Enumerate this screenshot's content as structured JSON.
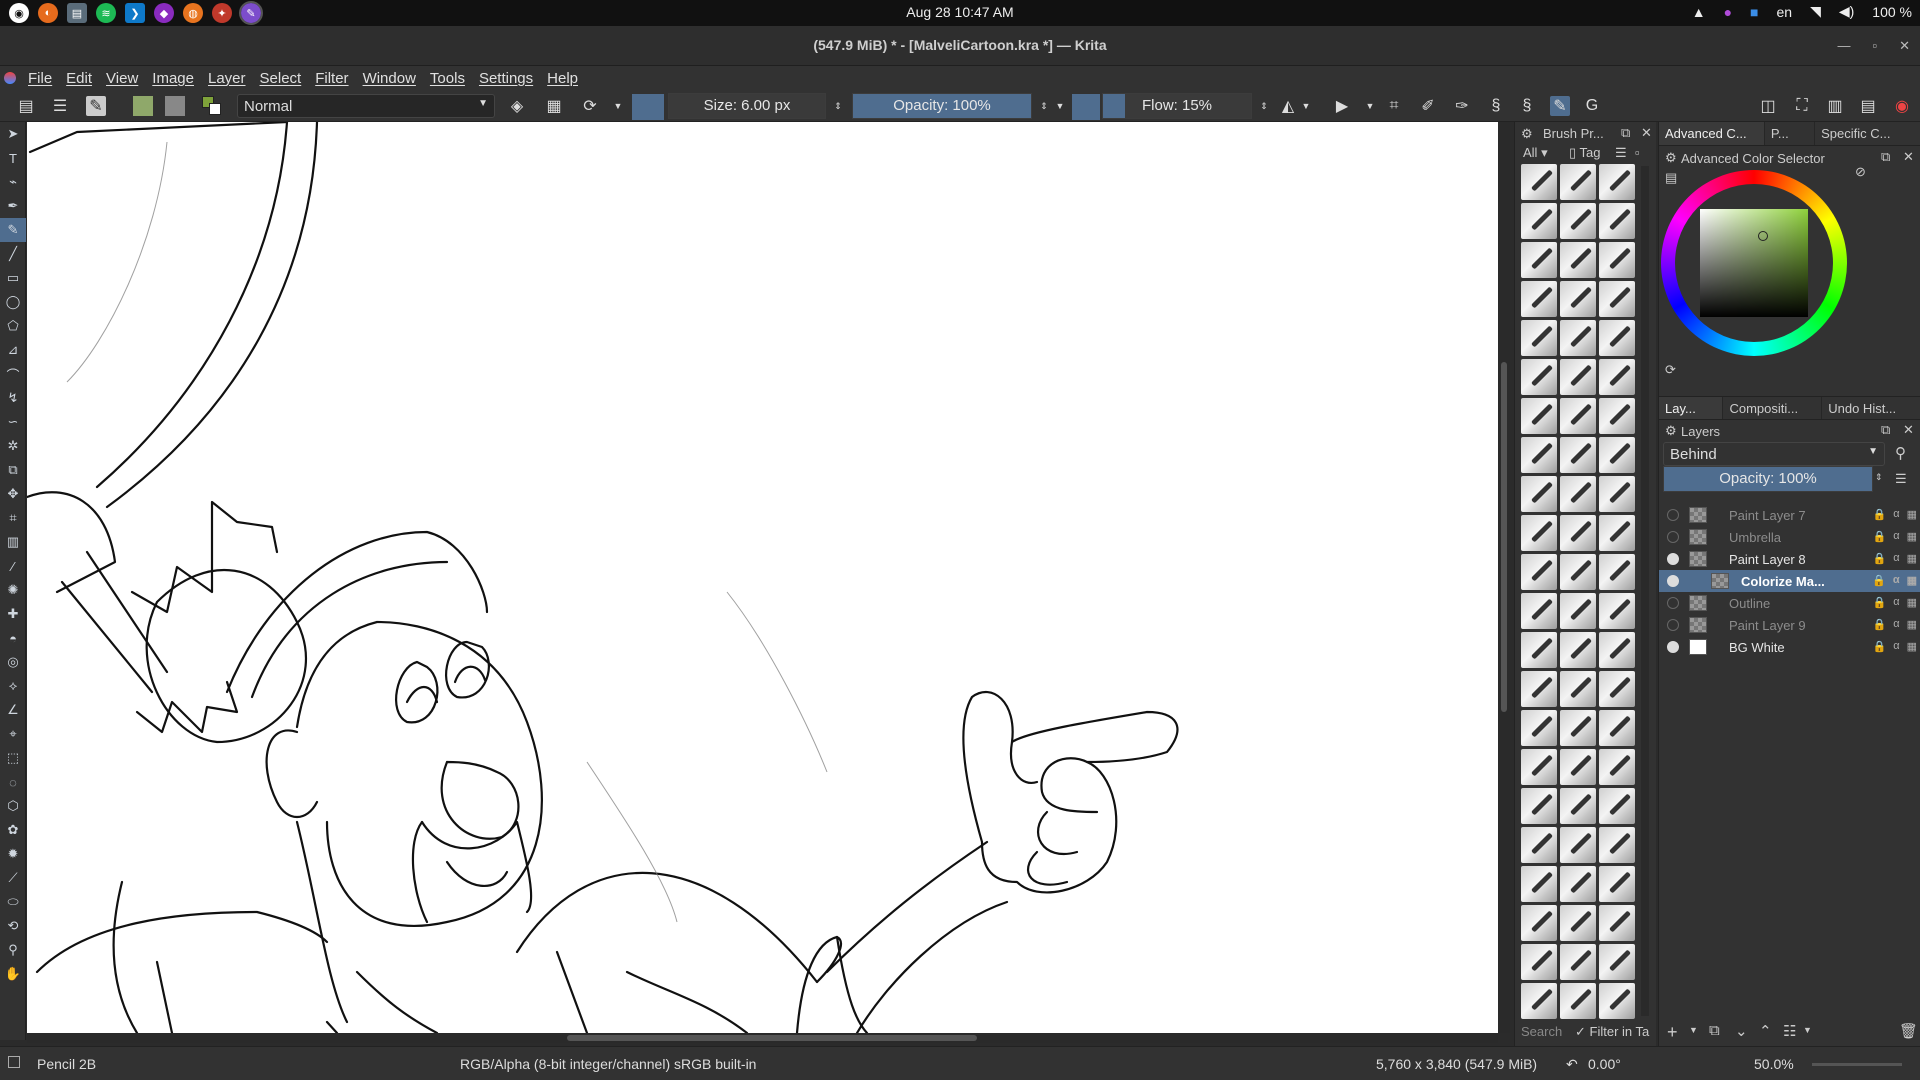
{
  "system": {
    "clock": "Aug 28  10:47 AM",
    "lang": "en",
    "battery": "100 %"
  },
  "window": {
    "title": "(547.9 MiB)  * - [MalveliCartoon.kra *] — Krita"
  },
  "menubar": [
    "File",
    "Edit",
    "View",
    "Image",
    "Layer",
    "Select",
    "Filter",
    "Window",
    "Tools",
    "Settings",
    "Help"
  ],
  "toolbar": {
    "blend_mode": "Normal",
    "size_label": "Size: 6.00 px",
    "opacity_label": "Opacity: 100%",
    "opacity_value": 1.0,
    "flow_label": "Flow: 15%",
    "flow_value": 0.15
  },
  "brush_presets": {
    "title": "Brush Pr...",
    "filter_tag": "All",
    "tag_label": "Tag",
    "search_placeholder": "Search",
    "filter_in_tag": "Filter in Ta"
  },
  "color_panel": {
    "tabs": [
      "Advanced C...",
      "P...",
      "Specific C..."
    ],
    "title": "Advanced Color Selector",
    "selected_color": "#7fa33a"
  },
  "layers_panel": {
    "tabs": [
      "Lay...",
      "Compositi...",
      "Undo Hist..."
    ],
    "title": "Layers",
    "blend_mode": "Behind",
    "opacity_label": "Opacity:  100%",
    "layers": [
      {
        "name": "Paint Layer 7",
        "visible": false,
        "selected": false
      },
      {
        "name": "Umbrella",
        "visible": false,
        "selected": false
      },
      {
        "name": "Paint Layer 8",
        "visible": true,
        "selected": false
      },
      {
        "name": "Colorize Ma...",
        "visible": true,
        "selected": true
      },
      {
        "name": "Outline",
        "visible": false,
        "selected": false
      },
      {
        "name": "Paint Layer 9",
        "visible": false,
        "selected": false
      },
      {
        "name": "BG White",
        "visible": true,
        "selected": false
      }
    ]
  },
  "statusbar": {
    "brush": "Pencil 2B",
    "color_profile": "RGB/Alpha (8-bit integer/channel)  sRGB built-in",
    "image_size": "5,760 x 3,840 (547.9 MiB)",
    "rotation": "0.00°",
    "zoom": "50.0%"
  }
}
